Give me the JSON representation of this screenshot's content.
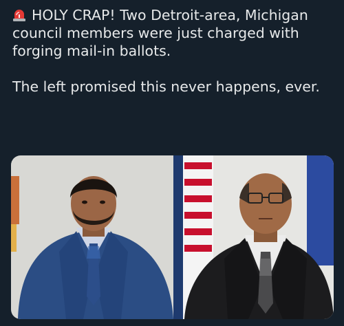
{
  "post": {
    "line1": "HOLY CRAP! Two Detroit-area, Michigan council members were just charged with forging mail-in ballots.",
    "line2": "The left promised this never happens, ever."
  },
  "icons": {
    "emoji": "siren-icon"
  },
  "media": {
    "photo_left": "man in blue suit and blue tie",
    "photo_right": "man in black suit and patterned tie with glasses"
  }
}
